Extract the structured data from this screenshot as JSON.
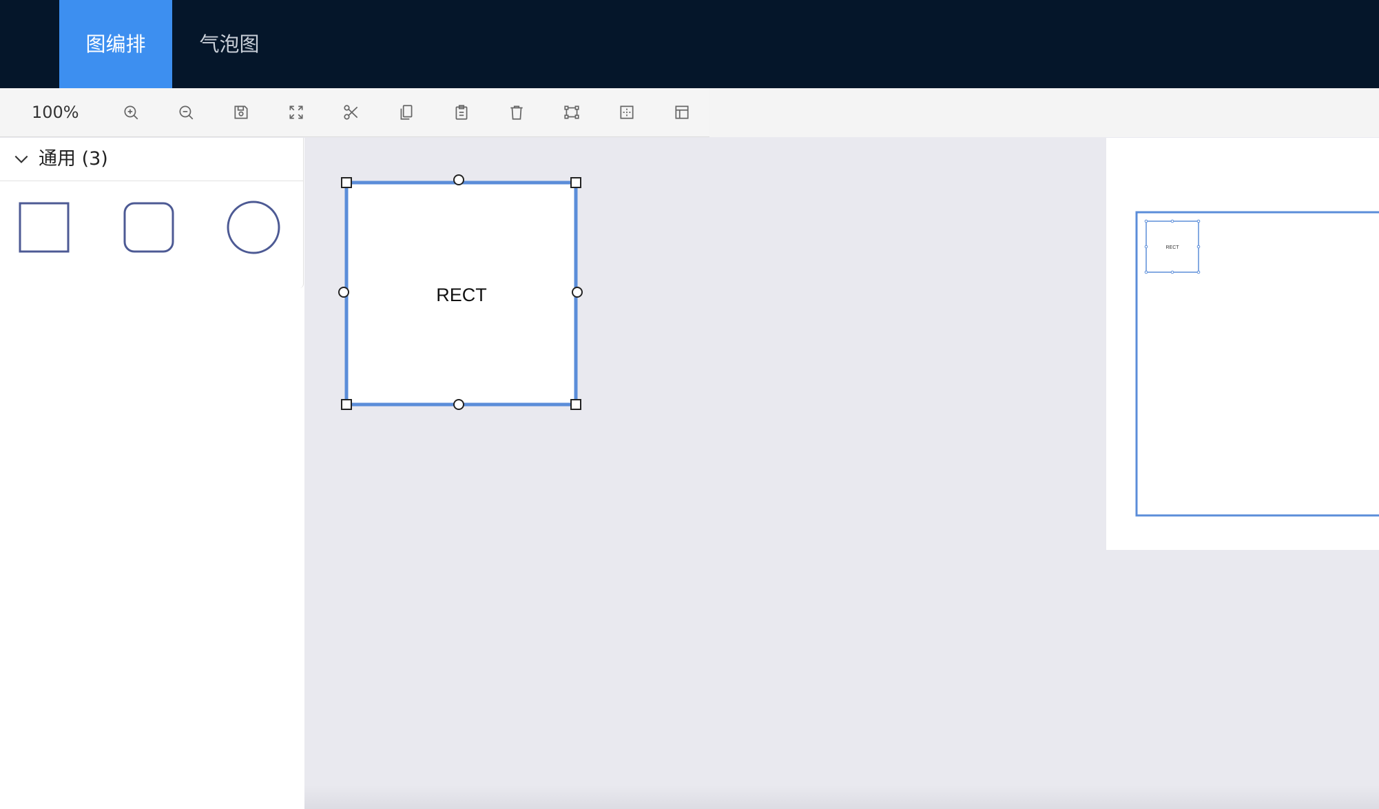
{
  "nav": {
    "tabs": [
      {
        "label": "图编排",
        "active": true
      },
      {
        "label": "气泡图",
        "active": false
      }
    ]
  },
  "toolbar": {
    "zoom": "100%",
    "icons": [
      "zoom-in-icon",
      "zoom-out-icon",
      "save-icon",
      "fit-screen-icon",
      "cut-icon",
      "copy-icon",
      "paste-icon",
      "delete-icon",
      "select-shape-icon",
      "grid-icon",
      "layout-icon"
    ]
  },
  "sidebar": {
    "group_title": "通用 (3)",
    "shapes": [
      "rectangle",
      "rounded-rectangle",
      "circle"
    ]
  },
  "canvas": {
    "node_label": "RECT"
  },
  "minimap": {
    "node_label": "RECT"
  },
  "colors": {
    "topbar": "#05162a",
    "active_tab": "#3d8ff0",
    "selection": "#5b8dd9",
    "shape_stroke": "#4d5a94",
    "canvas_bg": "#e9e9ef"
  }
}
